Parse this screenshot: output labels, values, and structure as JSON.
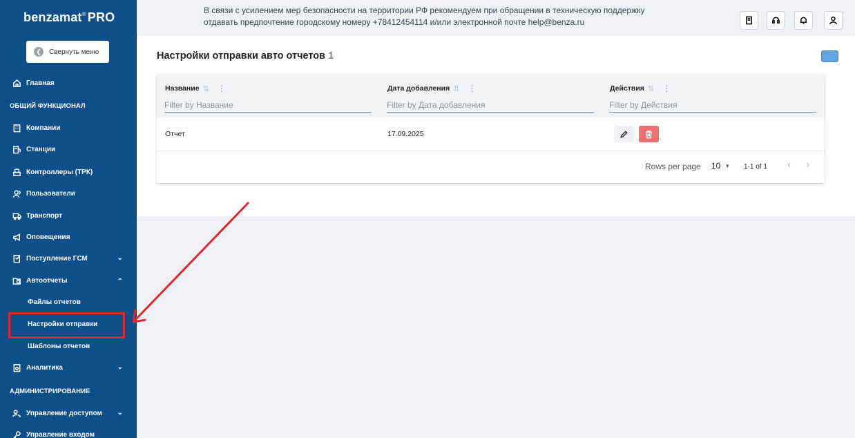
{
  "sidebar": {
    "brand": "benzamat",
    "brand_mark": "®",
    "brand_suffix": "PRO",
    "collapse_label": "Свернуть меню",
    "home": "Главная",
    "section_general": "ОБЩИЙ ФУНКЦИОНАЛ",
    "items": [
      {
        "label": "Компании",
        "icon": "building-icon"
      },
      {
        "label": "Станции",
        "icon": "station-icon"
      },
      {
        "label": "Контроллеры (ТРК)",
        "icon": "controller-icon"
      },
      {
        "label": "Пользователи",
        "icon": "users-icon"
      },
      {
        "label": "Транспорт",
        "icon": "truck-icon"
      },
      {
        "label": "Оповещения",
        "icon": "megaphone-icon"
      },
      {
        "label": "Поступление ГСМ",
        "icon": "receipt-icon"
      },
      {
        "label": "Автоотчеты",
        "icon": "clock-folder-icon"
      }
    ],
    "sub_items": [
      "Файлы отчетов",
      "Настройки отправки",
      "Шаблоны отчетов"
    ],
    "analytics": "Аналитика",
    "section_admin": "АДМИНИСТРИРОВАНИЕ",
    "access": "Управление доступом",
    "login": "Управление входом"
  },
  "header": {
    "notice_line1": "В связи с усилением мер безопасности на территории РФ рекомендуем при обращении в техническую поддержку",
    "notice_line2": "отдавать предпочтение городскому номеру +78412454114 и/или электронной почте help@benza.ru"
  },
  "main": {
    "title": "Настройки отправки авто отчетов",
    "count": "1",
    "columns": [
      {
        "label": "Название",
        "filter_placeholder": "Filter by Название"
      },
      {
        "label": "Дата добавления",
        "filter_placeholder": "Filter by Дата добавления"
      },
      {
        "label": "Действия",
        "filter_placeholder": "Filter by Действия"
      }
    ],
    "rows": [
      {
        "name": "Отчет",
        "date": "17.09.2025"
      }
    ],
    "pagination": {
      "rows_per_page_label": "Rows per page",
      "rows_per_page": "10",
      "range": "1-1 of 1"
    }
  },
  "colors": {
    "sidebar_bg": "#0d4f8b",
    "accent_red": "#e3262e",
    "delete_red": "#ee6f6f",
    "action_blue": "#5fa6e0"
  }
}
